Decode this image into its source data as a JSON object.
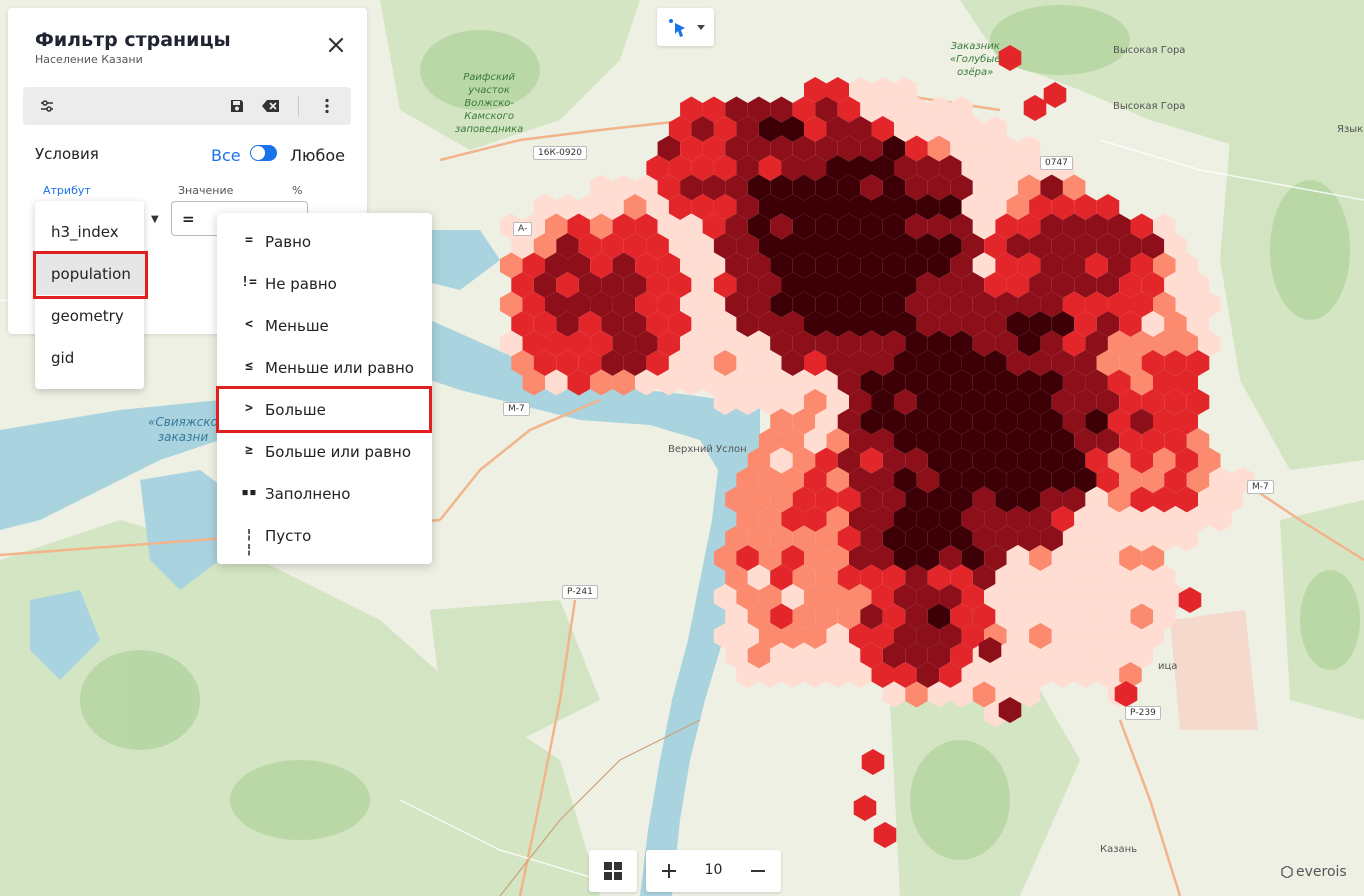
{
  "filter": {
    "title": "Фильтр страницы",
    "subtitle": "Население Казани",
    "conditions_label": "Условия",
    "mode_all": "Все",
    "mode_any": "Любое",
    "columns": {
      "attribute": "Атрибут",
      "value": "Значение",
      "percent": "%"
    },
    "operator_value": "="
  },
  "attribute_options": [
    {
      "label": "h3_index"
    },
    {
      "label": "population",
      "selected": true
    },
    {
      "label": "geometry"
    },
    {
      "label": "gid"
    }
  ],
  "operator_options": [
    {
      "symbol": "=",
      "label": "Равно"
    },
    {
      "symbol": "!=",
      "label": "Не равно"
    },
    {
      "symbol": "<",
      "label": "Меньше"
    },
    {
      "symbol": "≤",
      "label": "Меньше или равно"
    },
    {
      "symbol": ">",
      "label": "Больше",
      "highlighted": true
    },
    {
      "symbol": "≥",
      "label": "Больше или равно"
    },
    {
      "symbol": "▪▪",
      "label": "Заполнено"
    },
    {
      "symbol": "¦ ¦",
      "label": "Пусто"
    }
  ],
  "map": {
    "zoom": "10",
    "brand": "everois",
    "labels": {
      "raifa": "Раифский\nучасток\nВолжско-\nКамского\nзаповедника",
      "golubye": "Заказник\n«Голубые\nозёра»",
      "vysokaya1": "Высокая Гора",
      "vysokaya2": "Высокая Гора",
      "verkhny": "Верхний Услон",
      "sviyazhsk": "«Свияжско\nзаказни",
      "kazan": "Казань",
      "yazyk": "Язык",
      "tsa": "ица"
    },
    "shields": {
      "r16k": "16К-0920",
      "m7a": "М-7",
      "m7b": "М-7",
      "r241": "Р-241",
      "r239": "Р-239",
      "n747": "0747",
      "a": "А-"
    },
    "colors": {
      "water": "#a9d3de",
      "level1": "#ffddd3",
      "level2": "#fb8a6e",
      "level3": "#e3262a",
      "level4": "#8c0f1a",
      "level5": "#3d0006"
    }
  },
  "icons": {
    "close": "close-icon",
    "filter_settings": "sliders-icon",
    "save": "save-icon",
    "clear": "backspace-icon",
    "more": "more-vertical-icon",
    "select": "pointer-icon",
    "grid": "grid-icon"
  }
}
